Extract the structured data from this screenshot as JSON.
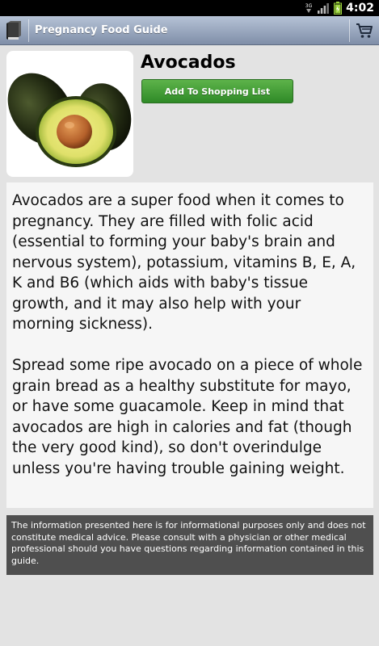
{
  "status_bar": {
    "time": "4:02",
    "icons": [
      "data-3g-icon",
      "signal-icon",
      "battery-icon"
    ],
    "network_label": "3G"
  },
  "action_bar": {
    "title": "Pregnancy Food Guide",
    "background": "#8f9db5"
  },
  "food": {
    "name": "Avocados",
    "add_button_label": "Add To Shopping List",
    "add_button_color": "#3f9a33",
    "description": "Avocados are a super food when it comes to pregnancy. They are filled with folic acid (essential to forming your baby's brain and nervous system), potassium, vitamins B, E, A, K and B6 (which aids with baby's tissue growth, and it may also help with your morning sickness).\n\nSpread some ripe avocado on a piece of whole grain bread as a healthy substitute for mayo, or have some guacamole. Keep in mind that avocados are high in calories and fat (though the very good kind), so don't overindulge unless you're having trouble gaining weight."
  },
  "disclaimer": "The information presented here is for informational purposes only and does not constitute medical advice. Please consult with a physician or other medical professional should you have questions regarding information contained in this guide."
}
